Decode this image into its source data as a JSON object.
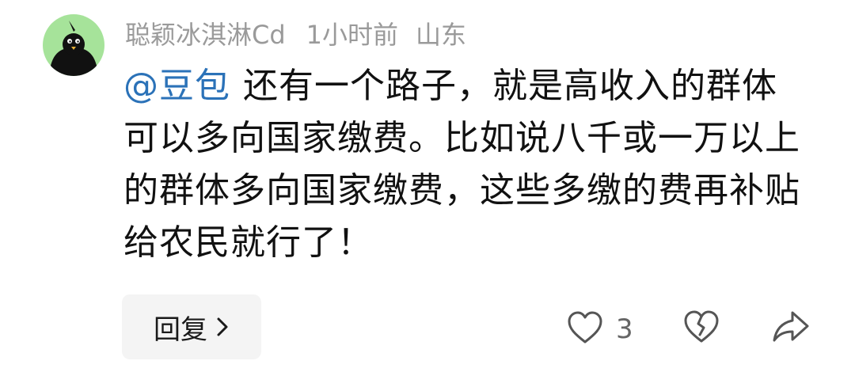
{
  "comment": {
    "author": "聪颖冰淇淋Cd",
    "time": "1小时前",
    "location": "山东",
    "mention": "@豆包",
    "text": "还有一个路子，就是高收入的群体可以多向国家缴费。比如说八千或一万以上的群体多向国家缴费，这些多缴的费再补贴给农民就行了！",
    "avatar_bg": "#a6e39a",
    "mention_color": "#2b72b8"
  },
  "actions": {
    "reply_label": "回复",
    "like_count": "3",
    "like_icon": "heart-outline-icon",
    "dislike_icon": "broken-heart-icon",
    "share_icon": "share-arrow-icon"
  }
}
